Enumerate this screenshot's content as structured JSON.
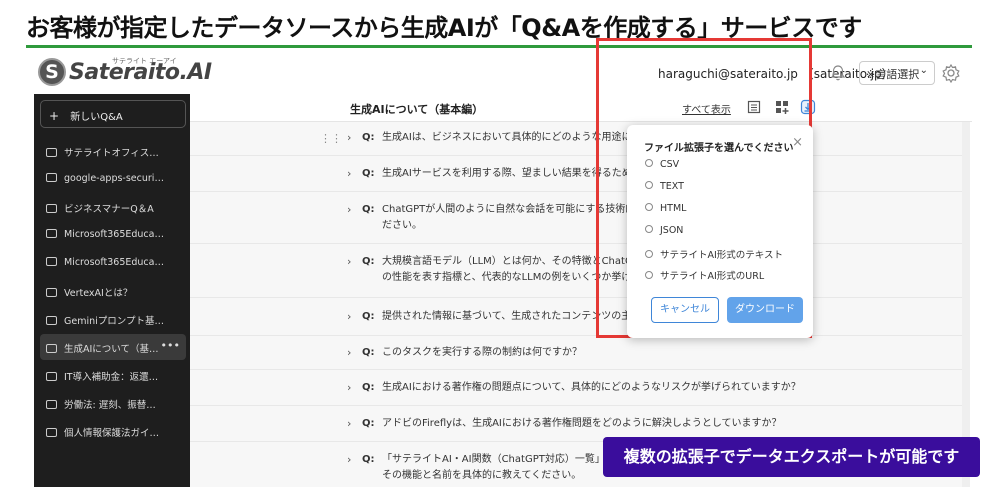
{
  "headline": "お客様が指定したデータソースから生成AIが「Q&Aを作成する」サービスです",
  "logo": {
    "text": "Sateraito.AI",
    "kana": "サテライト エーアイ"
  },
  "header": {
    "email": "haraguchi@sateraito.jp （sateraito.jp）",
    "language": "※言語選択"
  },
  "sidebar": {
    "new_chat": "新しいQ&A",
    "items": [
      {
        "label": "サテライトオフィス…"
      },
      {
        "label": "google-apps-securi…"
      },
      {
        "label": "ビジネスマナーQ＆A"
      },
      {
        "label": "Microsoft365Educa…"
      },
      {
        "label": "Microsoft365Educa…"
      },
      {
        "label": "VertexAIとは？"
      },
      {
        "label": "Geminiプロンプト基…"
      },
      {
        "label": "生成AIについて（基…"
      },
      {
        "label": "IT導入補助金：返還…"
      },
      {
        "label": "労働法: 遅刻、振替…"
      },
      {
        "label": "個人情報保護法ガイ…"
      }
    ]
  },
  "main": {
    "title": "生成AIについて（基本編）",
    "show_all": "すべて表示",
    "questions": [
      {
        "q": "Q:",
        "text": "生成AIは、ビジネスにおいて具体的にどのような用途に活用で"
      },
      {
        "q": "Q:",
        "text": "生成AIサービスを利用する際、望ましい結果を得るためのプロ"
      },
      {
        "q": "Q:",
        "text": "ChatGPTが人間のように自然な会話を可能にする技術的基盤は"
      },
      {
        "q": "Q:",
        "text": "大規模言語モデル（LLM）とは何か、その特徴とChatGPTとの"
      },
      {
        "q": "Q:",
        "text": "提供された情報に基づいて、生成されたコンテンツの主な目的"
      },
      {
        "q": "Q:",
        "text": "このタスクを実行する際の制約は何ですか？"
      },
      {
        "q": "Q:",
        "text": "生成AIにおける著作権の問題点について、具体的にどのようなリスクが挙げられていますか？"
      },
      {
        "q": "Q:",
        "text": "アドビのFireflyは、生成AIにおける著作権問題をどのように解決しようとしていますか？"
      },
      {
        "q": "Q:",
        "text": "「サテライトAI・AI関数（ChatGPT対応）一覧」に記載"
      }
    ],
    "question_cont": [
      "ださい。",
      "の性能を表す指標と、代表的なLLMの例をいくつか挙げてくだ",
      "その機能と名前を具体的に教えてください。"
    ]
  },
  "modal": {
    "title": "ファイル拡張子を選んでください",
    "close": "×",
    "options": [
      "CSV",
      "TEXT",
      "HTML",
      "JSON",
      "サテライトAI形式のテキスト",
      "サテライトAI形式のURL"
    ],
    "cancel": "キャンセル",
    "download": "ダウンロード"
  },
  "badge": "複数の拡張子でデータエクスポートが可能です",
  "colors": {
    "accent_green": "#2f9a3c",
    "highlight_red": "#e53935",
    "badge_purple": "#3a0d9c",
    "button_blue": "#62a3ea"
  }
}
